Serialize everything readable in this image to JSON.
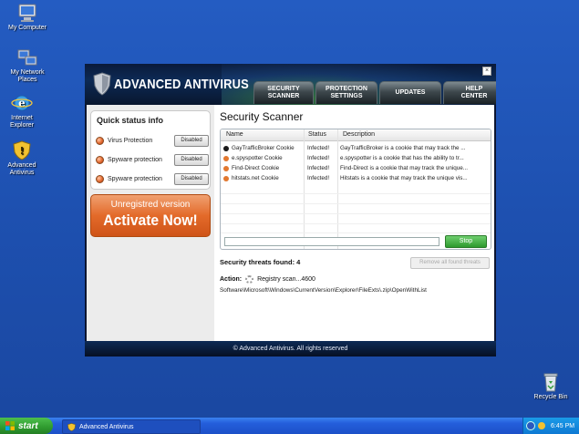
{
  "desktop": {
    "icons": [
      {
        "label1": "My Computer",
        "label2": ""
      },
      {
        "label1": "My Network",
        "label2": "Places"
      },
      {
        "label1": "Internet",
        "label2": "Explorer"
      },
      {
        "label1": "Advanced",
        "label2": "Antivirus"
      }
    ],
    "recycle": "Recycle Bin"
  },
  "window": {
    "app_name": "ADVANCED ANTIVIRUS",
    "close": "×",
    "tabs": [
      {
        "line1": "SECURITY",
        "line2": "SCANNER"
      },
      {
        "line1": "PROTECTION",
        "line2": "SETTINGS"
      },
      {
        "line1": "UPDATES",
        "line2": ""
      },
      {
        "line1": "HELP",
        "line2": "CENTER"
      }
    ],
    "footer": "© Advanced Antivirus. All rights reserved"
  },
  "sidebar": {
    "title": "Quick status info",
    "rows": [
      {
        "label": "Virus Protection",
        "state": "Disabled"
      },
      {
        "label": "Spyware protection",
        "state": "Disabled"
      },
      {
        "label": "Spyware protection",
        "state": "Disabled"
      }
    ],
    "activate_line1": "Unregistred version",
    "activate_line2": "Activate Now!"
  },
  "scanner": {
    "title": "Security Scanner",
    "columns": {
      "name": "Name",
      "status": "Status",
      "description": "Description"
    },
    "rows": [
      {
        "name": "GayTrafficBroker Cookie",
        "status": "Infected!",
        "description": "GayTrafficBroker is a cookie that may track the ...",
        "color": "#1a1a1a"
      },
      {
        "name": "e.spyspotter Cookie",
        "status": "Infected!",
        "description": "e.spyspotter is a cookie that has the ability to tr...",
        "color": "#e2782f"
      },
      {
        "name": "Find-Direct Cookie",
        "status": "Infected!",
        "description": "Find-Direct is a cookie that may track the unique...",
        "color": "#e2782f"
      },
      {
        "name": "hitstats.net Cookie",
        "status": "Infected!",
        "description": "Hitstats is a cookie that may track the unique vis...",
        "color": "#e2782f"
      }
    ],
    "stop": "Stop",
    "threats_label": "Security threats found: 4",
    "remove_label": "Remove all found threats",
    "action_label": "Action:",
    "action_text": "Registry scan...4600",
    "path": "Software\\Microsoft\\Windows\\CurrentVersion\\Explorer\\FileExts\\.zip\\OpenWithList"
  },
  "taskbar": {
    "start": "start",
    "task": "Advanced Antivirus",
    "time": "6:45 PM"
  }
}
